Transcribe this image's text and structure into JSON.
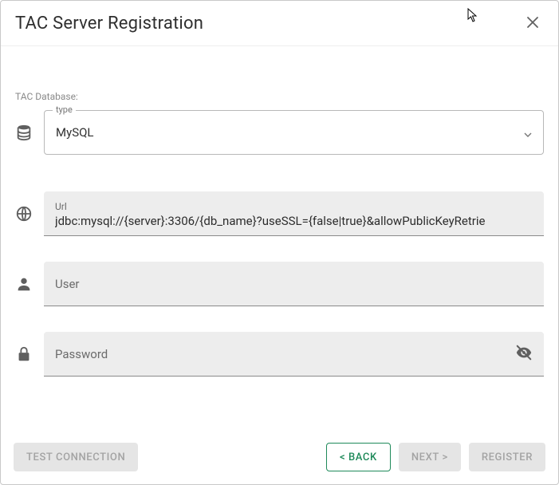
{
  "dialog": {
    "title": "TAC Server Registration",
    "section_label": "TAC Database:"
  },
  "fields": {
    "type": {
      "label": "type",
      "value": "MySQL"
    },
    "url": {
      "label": "Url",
      "value": "jdbc:mysql://{server}:3306/{db_name}?useSSL={false|true}&allowPublicKeyRetrie"
    },
    "user": {
      "label": "User",
      "value": ""
    },
    "password": {
      "label": "Password",
      "value": ""
    }
  },
  "buttons": {
    "test_connection": "TEST CONNECTION",
    "back": "< BACK",
    "next": "NEXT >",
    "register": "REGISTER"
  }
}
